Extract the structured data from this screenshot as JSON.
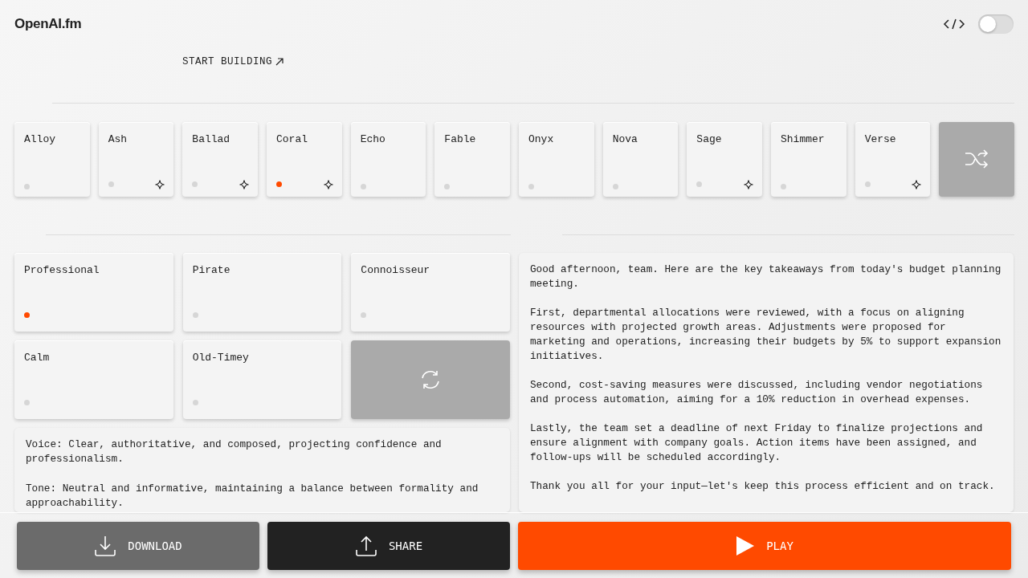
{
  "logo": "OpenAI.fm",
  "code_toggle": {
    "on": false
  },
  "start_building": "START BUILDING",
  "voices": [
    {
      "name": "Alloy",
      "selected": false,
      "featured": false
    },
    {
      "name": "Ash",
      "selected": false,
      "featured": true
    },
    {
      "name": "Ballad",
      "selected": false,
      "featured": true
    },
    {
      "name": "Coral",
      "selected": true,
      "featured": true
    },
    {
      "name": "Echo",
      "selected": false,
      "featured": false
    },
    {
      "name": "Fable",
      "selected": false,
      "featured": false
    },
    {
      "name": "Onyx",
      "selected": false,
      "featured": false
    },
    {
      "name": "Nova",
      "selected": false,
      "featured": false
    },
    {
      "name": "Sage",
      "selected": false,
      "featured": true
    },
    {
      "name": "Shimmer",
      "selected": false,
      "featured": false
    },
    {
      "name": "Verse",
      "selected": false,
      "featured": true
    }
  ],
  "vibes": [
    {
      "name": "Professional",
      "selected": true
    },
    {
      "name": "Pirate",
      "selected": false
    },
    {
      "name": "Connoisseur",
      "selected": false
    },
    {
      "name": "Calm",
      "selected": false
    },
    {
      "name": "Old-Timey",
      "selected": false
    }
  ],
  "instructions": [
    "Voice: Clear, authoritative, and composed, projecting confidence and professionalism.",
    "Tone: Neutral and informative, maintaining a balance between formality and approachability."
  ],
  "script": [
    "Good afternoon, team. Here are the key takeaways from today's budget planning meeting.",
    "First, departmental allocations were reviewed, with a focus on aligning resources with projected growth areas. Adjustments were proposed for marketing and operations, increasing their budgets by 5% to support expansion initiatives.",
    "Second, cost-saving measures were discussed, including vendor negotiations and process automation, aiming for a 10% reduction in overhead expenses.",
    "Lastly, the team set a deadline of next Friday to finalize projections and ensure alignment with company goals. Action items have been assigned, and follow-ups will be scheduled accordingly.",
    "Thank you all for your input—let's keep this process efficient and on track."
  ],
  "actions": [
    {
      "kind": "download",
      "label": "DOWNLOAD"
    },
    {
      "kind": "share",
      "label": "SHARE"
    },
    {
      "kind": "play",
      "label": "PLAY"
    }
  ]
}
